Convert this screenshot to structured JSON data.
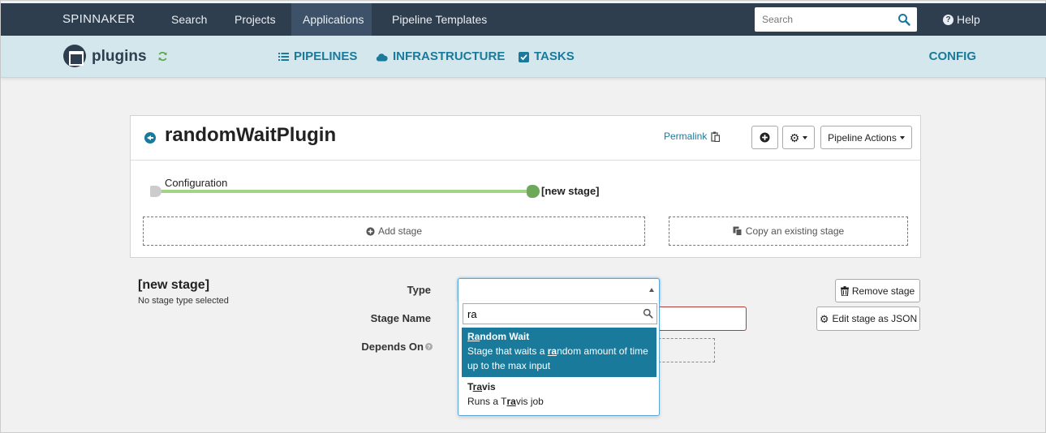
{
  "topnav": {
    "brand": "SPINNAKER",
    "links": [
      "Search",
      "Projects",
      "Applications",
      "Pipeline Templates"
    ],
    "search_placeholder": "Search",
    "help": "Help"
  },
  "appbar": {
    "app_name": "plugins",
    "tabs": [
      "PIPELINES",
      "INFRASTRUCTURE",
      "TASKS"
    ],
    "config": "CONFIG"
  },
  "pipeline": {
    "name": "randomWaitPlugin",
    "permalink": "Permalink",
    "actions": "Pipeline Actions",
    "nodes": {
      "start": "Configuration",
      "end": "[new stage]"
    },
    "add_stage": "Add stage",
    "copy_stage": "Copy an existing stage"
  },
  "stage": {
    "title": "[new stage]",
    "subtitle": "No stage type selected",
    "labels": {
      "type": "Type",
      "stage_name": "Stage Name",
      "depends_on": "Depends On"
    },
    "remove": "Remove stage",
    "edit_json": "Edit stage as JSON"
  },
  "type_dropdown": {
    "query": "ra",
    "options": [
      {
        "title_pre": "",
        "title_match": "Ra",
        "title_post": "ndom Wait",
        "desc_pre": "Stage that waits a ",
        "desc_match": "ra",
        "desc_post": "ndom amount of time up to the max input",
        "highlighted": true
      },
      {
        "title_pre": "T",
        "title_match": "ra",
        "title_post": "vis",
        "desc_pre": "Runs a T",
        "desc_match": "ra",
        "desc_post": "vis job",
        "highlighted": false
      }
    ]
  },
  "colors": {
    "navbar": "#2e3e4e",
    "appbar": "#d3e7ec",
    "accent": "#197a9c",
    "highlight": "#197a9c"
  }
}
